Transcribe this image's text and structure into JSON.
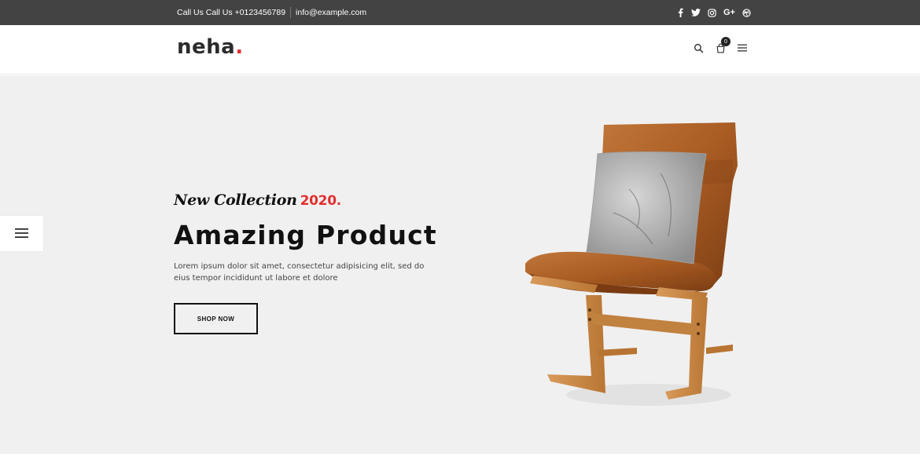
{
  "topbar": {
    "phone": "Call Us Call Us +0123456789",
    "email": "info@example.com",
    "social": [
      {
        "icon": "facebook-icon",
        "glyph": "f"
      },
      {
        "icon": "twitter-icon",
        "glyph": "t"
      },
      {
        "icon": "instagram-icon",
        "glyph": "ig"
      },
      {
        "icon": "google-plus-icon",
        "glyph": "G+"
      },
      {
        "icon": "dribbble-icon",
        "glyph": "db"
      }
    ]
  },
  "header": {
    "logo_text": "neha",
    "logo_dot": ".",
    "cart_count": "0",
    "icons": [
      "search-icon",
      "cart-icon",
      "menu-icon"
    ]
  },
  "hero": {
    "tagline": "New Collection",
    "year": "2020.",
    "headline": "Amazing Product",
    "description": "Lorem ipsum dolor sit amet, consectetur adipisicing elit, sed do eius tempor incididunt ut labore et dolore",
    "button_label": "SHOP NOW"
  },
  "colors": {
    "topbar_bg": "#434343",
    "hero_bg": "#f0f0f0",
    "accent": "#e32f2f"
  }
}
